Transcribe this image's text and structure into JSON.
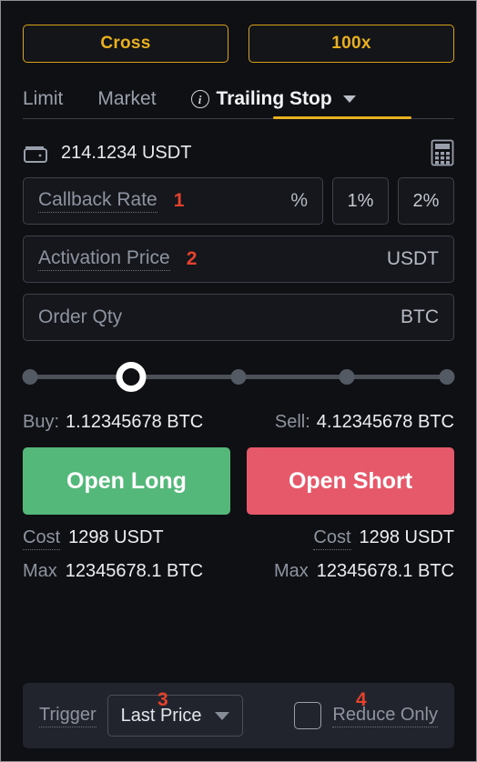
{
  "margin": {
    "mode_label": "Cross",
    "leverage_label": "100x"
  },
  "tabs": [
    {
      "label": "Limit",
      "active": false
    },
    {
      "label": "Market",
      "active": false
    },
    {
      "label": "Trailing Stop",
      "active": true
    }
  ],
  "balance": {
    "icon": "wallet-icon",
    "amount": "214.1234 USDT",
    "calculator_icon": "calculator-icon"
  },
  "form": {
    "callback_rate": {
      "placeholder": "Callback Rate",
      "value": "",
      "suffix": "%",
      "marker": "1"
    },
    "presets": [
      {
        "label": "1%"
      },
      {
        "label": "2%"
      }
    ],
    "activation_price": {
      "placeholder": "Activation Price",
      "value": "",
      "suffix": "USDT",
      "marker": "2"
    },
    "order_qty": {
      "placeholder": "Order Qty",
      "value": "",
      "suffix": "BTC"
    }
  },
  "slider": {
    "value_percent": 25,
    "stops": [
      0,
      25,
      50,
      75,
      100
    ]
  },
  "summary": {
    "buy_label": "Buy:",
    "buy_value": "1.12345678 BTC",
    "sell_label": "Sell:",
    "sell_value": "4.12345678 BTC"
  },
  "actions": {
    "long_label": "Open Long",
    "short_label": "Open Short",
    "long_color": "#54b87a",
    "short_color": "#e5596b"
  },
  "details": {
    "long_cost_label": "Cost",
    "long_cost_value": "1298 USDT",
    "short_cost_label": "Cost",
    "short_cost_value": "1298 USDT",
    "long_max_label": "Max",
    "long_max_value": "12345678.1 BTC",
    "short_max_label": "Max",
    "short_max_value": "12345678.1 BTC"
  },
  "bottom": {
    "trigger_label": "Trigger",
    "trigger_value": "Last Price",
    "trigger_marker": "3",
    "reduce_only_label": "Reduce Only",
    "reduce_only_checked": false,
    "reduce_only_marker": "4"
  },
  "theme": {
    "accent": "#e9b020",
    "marker_red": "#e4422c",
    "background": "#0e1013"
  }
}
